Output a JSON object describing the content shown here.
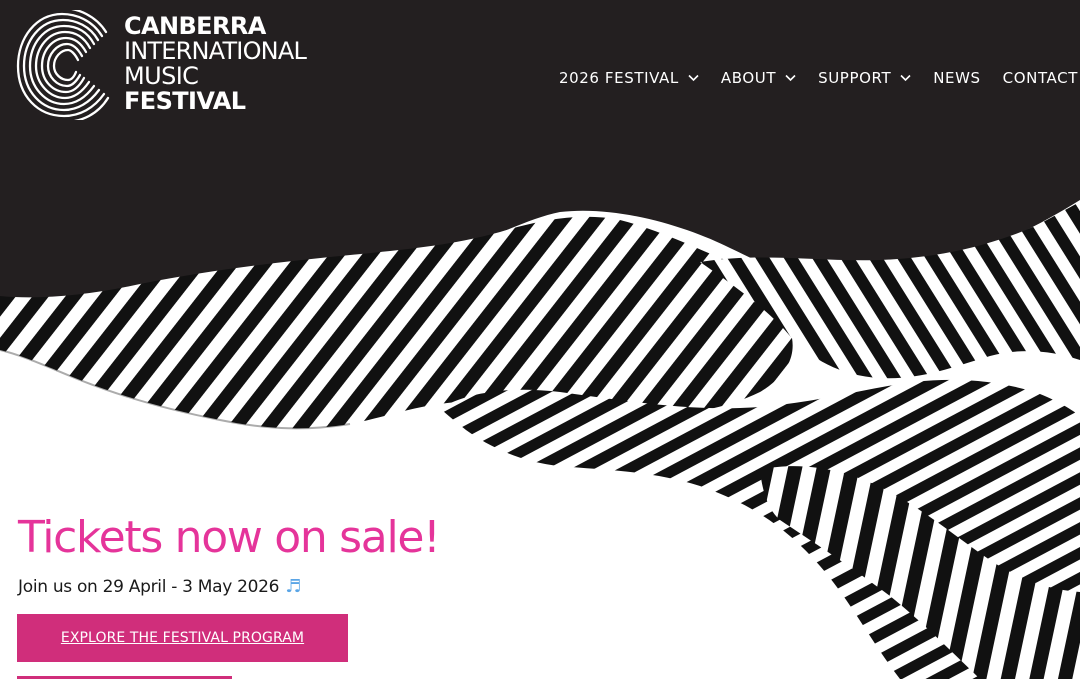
{
  "site": {
    "logo": {
      "icon": "cimf-logo-mark",
      "lines": [
        "CANBERRA",
        "INTERNATIONAL",
        "MUSIC",
        "FESTIVAL"
      ]
    }
  },
  "nav": {
    "items": [
      {
        "label": "2026 FESTIVAL",
        "has_dropdown": true,
        "icon": "chevron-down-icon"
      },
      {
        "label": "ABOUT",
        "has_dropdown": true,
        "icon": "chevron-down-icon"
      },
      {
        "label": "SUPPORT",
        "has_dropdown": true,
        "icon": "chevron-down-icon"
      },
      {
        "label": "NEWS",
        "has_dropdown": false
      },
      {
        "label": "CONTACT",
        "has_dropdown": false
      }
    ]
  },
  "hero": {
    "headline": "Tickets now on sale!",
    "subline": "Join us on 29 April - 3 May 2026",
    "subline_icon": "music-notes-icon",
    "subline_icon_glyph": "♬",
    "cta_label": "EXPLORE THE FESTIVAL PROGRAM"
  },
  "colors": {
    "header_bg": "#231f20",
    "headline_pink": "#e5349a",
    "button_bg": "#d02e7b",
    "nav_text": "#ffffff"
  }
}
